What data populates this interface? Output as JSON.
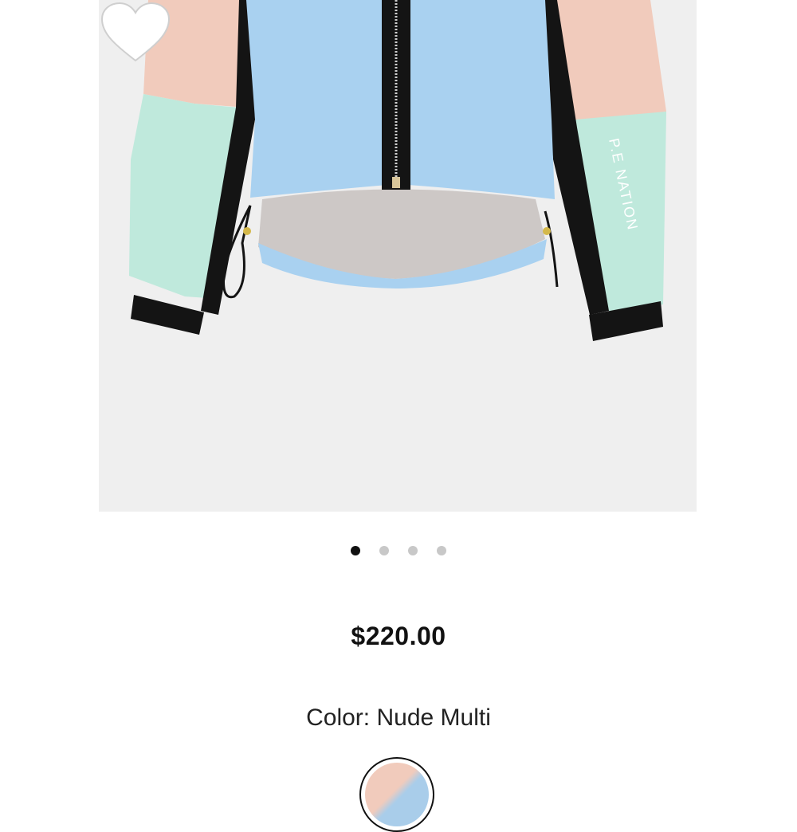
{
  "product": {
    "price": "$220.00",
    "color_label": "Color:",
    "color_value": "Nude Multi",
    "image_logo_text": "P.E NATION"
  },
  "carousel": {
    "total_slides": 4,
    "active_slide": 1
  },
  "icons": {
    "wishlist": "heart-outline-icon"
  },
  "colors": {
    "image_background": "#efefef",
    "jacket_blue": "#a9d1f0",
    "jacket_peach": "#f1cbbc",
    "jacket_mint": "#bfe9dc",
    "jacket_black": "#141414",
    "active_dot": "#111111",
    "inactive_dot": "#c8c8c8"
  }
}
